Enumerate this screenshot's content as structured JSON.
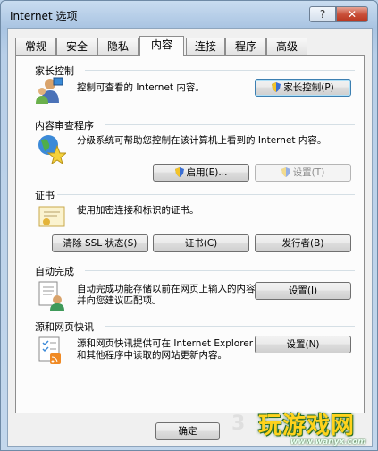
{
  "window": {
    "title": "Internet 选项",
    "help_label": "?",
    "close_label": "✕"
  },
  "tabs": [
    {
      "label": "常规"
    },
    {
      "label": "安全"
    },
    {
      "label": "隐私"
    },
    {
      "label": "内容",
      "active": true
    },
    {
      "label": "连接"
    },
    {
      "label": "程序"
    },
    {
      "label": "高级"
    }
  ],
  "parental": {
    "title": "家长控制",
    "description": "控制可查看的 Internet 内容。",
    "button": "家长控制(P)",
    "icon": "parental-controls-icon"
  },
  "advisor": {
    "title": "内容审查程序",
    "description": "分级系统可帮助您控制在该计算机上看到的 Internet 内容。",
    "enable_button": "启用(E)...",
    "settings_button": "设置(T)",
    "icon": "content-advisor-icon"
  },
  "certificates": {
    "title": "证书",
    "description": "使用加密连接和标识的证书。",
    "clear_ssl_button": "清除 SSL 状态(S)",
    "certificates_button": "证书(C)",
    "publishers_button": "发行者(B)",
    "icon": "certificate-icon"
  },
  "autocomplete": {
    "title": "自动完成",
    "description": "自动完成功能存储以前在网页上输入的内容并向您建议匹配项。",
    "settings_button": "设置(I)",
    "icon": "autocomplete-icon"
  },
  "feeds": {
    "title": "源和网页快讯",
    "description": "源和网页快讯提供可在 Internet Explorer 和其他程序中读取的网站更新内容。",
    "settings_button": "设置(N)",
    "icon": "feeds-icon"
  },
  "footer": {
    "ok_button": "确定"
  },
  "watermark": {
    "text": "玩游戏网",
    "url": "www.wanyx.com",
    "digit": "3"
  },
  "colors": {
    "title_bar": "#b9d1ea",
    "close_button": "#c9503a",
    "watermark": "#ffd21c"
  }
}
